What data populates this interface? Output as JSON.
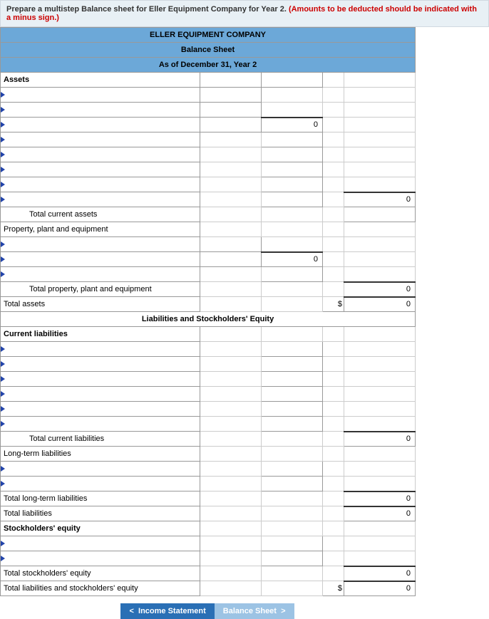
{
  "instructions": {
    "main_a": "Prepare a multistep Balance sheet for Eller Equipment Company for Year 2. ",
    "warn": "(Amounts to be deducted should be indicated with a minus sign.)"
  },
  "header": {
    "company": "ELLER EQUIPMENT COMPANY",
    "title": "Balance Sheet",
    "date": "As of December 31, Year 2"
  },
  "sections": {
    "assets": "Assets",
    "total_current_assets": "Total current assets",
    "ppe": "Property, plant and equipment",
    "total_ppe": "Total property, plant and equipment",
    "total_assets": "Total assets",
    "liab_eq": "Liabilities and Stockholders' Equity",
    "cur_liab": "Current liabilities",
    "total_cur_liab": "Total current liabilities",
    "lt_liab": "Long-term liabilities",
    "total_lt_liab": "Total long-term liabilities",
    "total_liab": "Total liabilities",
    "se": "Stockholders' equity",
    "total_se": "Total stockholders' equity",
    "total_liab_se": "Total liabilities and stockholders' equity"
  },
  "values": {
    "zero": "0",
    "dollar": "$"
  },
  "nav": {
    "prev": "Income Statement",
    "cur": "Balance Sheet"
  }
}
